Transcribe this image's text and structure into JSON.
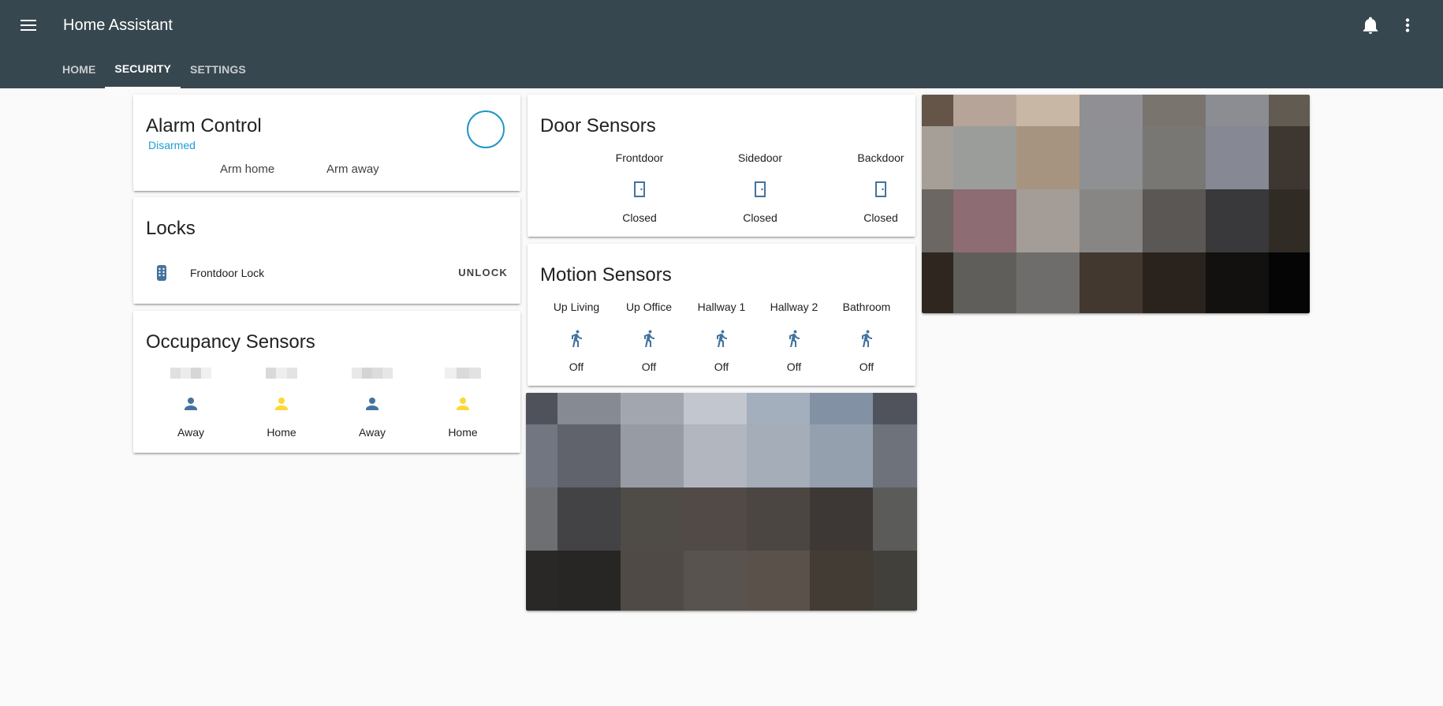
{
  "header": {
    "app_title": "Home Assistant",
    "menu_icon": "hamburger-menu-icon",
    "notifications_icon": "bell-icon",
    "overflow_icon": "more-vertical-icon",
    "background_color": "#37474f"
  },
  "tabs": [
    {
      "label": "HOME",
      "active": false
    },
    {
      "label": "SECURITY",
      "active": true
    },
    {
      "label": "SETTINGS",
      "active": false
    }
  ],
  "alarm_control": {
    "title": "Alarm Control",
    "status": "Disarmed",
    "status_color": "#1e9ed1",
    "arm_home_label": "Arm home",
    "arm_away_label": "Arm away"
  },
  "locks": {
    "title": "Locks",
    "items": [
      {
        "name": "Frontdoor Lock",
        "icon": "lock-keypad-icon",
        "action_label": "UNLOCK"
      }
    ]
  },
  "occupancy": {
    "title": "Occupancy Sensors",
    "people": [
      {
        "state": "Away",
        "icon": "person-icon",
        "color": "#44739e"
      },
      {
        "state": "Home",
        "icon": "person-icon",
        "color": "#fdd835"
      },
      {
        "state": "Away",
        "icon": "person-icon",
        "color": "#44739e"
      },
      {
        "state": "Home",
        "icon": "person-icon",
        "color": "#fdd835"
      }
    ]
  },
  "door_sensors": {
    "title": "Door Sensors",
    "items": [
      {
        "name": "Frontdoor",
        "state": "Closed",
        "icon": "door-closed-icon"
      },
      {
        "name": "Sidedoor",
        "state": "Closed",
        "icon": "door-closed-icon"
      },
      {
        "name": "Backdoor",
        "state": "Closed",
        "icon": "door-closed-icon"
      }
    ]
  },
  "motion_sensors": {
    "title": "Motion Sensors",
    "items": [
      {
        "name": "Up Living",
        "state": "Off",
        "icon": "motion-run-icon"
      },
      {
        "name": "Up Office",
        "state": "Off",
        "icon": "motion-run-icon"
      },
      {
        "name": "Hallway 1",
        "state": "Off",
        "icon": "motion-run-icon"
      },
      {
        "name": "Hallway 2",
        "state": "Off",
        "icon": "motion-run-icon"
      },
      {
        "name": "Bathroom",
        "state": "Off",
        "icon": "motion-run-icon"
      }
    ]
  },
  "icon_color": "#44739e",
  "camera_right": {
    "colors": [
      [
        "#655549",
        "#b6a498",
        "#c9b7a6",
        "#8f8f94",
        "#79746e",
        "#8c8d92",
        "#615b52"
      ],
      [
        "#a59f98",
        "#9b9d9b",
        "#a79480",
        "#8f9093",
        "#797773",
        "#868994",
        "#3e3631"
      ],
      [
        "#6c6762",
        "#8e6c73",
        "#a49c97",
        "#878684",
        "#5a5755",
        "#39383a",
        "#312b26"
      ],
      [
        "#2f2620",
        "#605e5a",
        "#6f6d6b",
        "#433830",
        "#2a231d",
        "#121110",
        "#050506"
      ]
    ]
  },
  "camera_bottom": {
    "colors": [
      [
        "#4f525a",
        "#868a93",
        "#a2a6ae",
        "#c1c6cf",
        "#a4afbe",
        "#8391a4",
        "#50535c"
      ],
      [
        "#717680",
        "#60636b",
        "#979ba3",
        "#b2b6be",
        "#a4adb8",
        "#95a0ae",
        "#6d727b"
      ],
      [
        "#6d6f72",
        "#434244",
        "#4f4b47",
        "#514a47",
        "#4b4642",
        "#3d3835",
        "#5b5c59"
      ],
      [
        "#2a2826",
        "#282624",
        "#4f4a46",
        "#58534f",
        "#5b514b",
        "#433c35",
        "#41403b"
      ]
    ]
  }
}
